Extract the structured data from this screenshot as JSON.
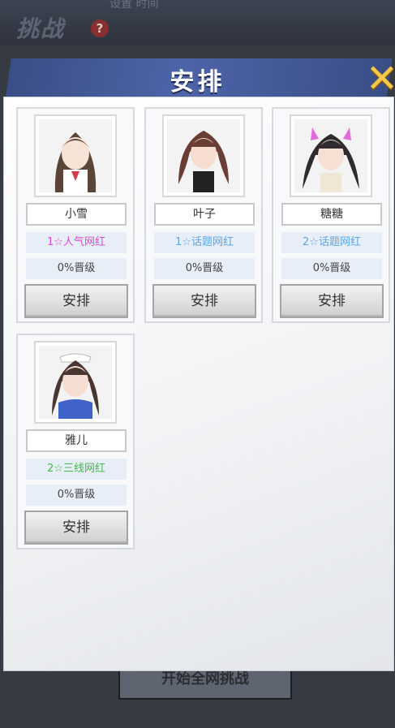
{
  "background": {
    "title": "挑战",
    "top_text": "设置 时间",
    "help_icon": "?",
    "start_button": "开始全网挑战"
  },
  "modal": {
    "title": "安排",
    "close_label": "✕"
  },
  "characters": [
    {
      "name": "小雪",
      "tier": "1☆人气网红",
      "tier_color": "#d94ad8",
      "progress": "0%晋级",
      "button": "安排",
      "hair": "#5b4438",
      "accent": "#d23b4a"
    },
    {
      "name": "叶子",
      "tier": "1☆话题网红",
      "tier_color": "#5aa6e6",
      "progress": "0%晋级",
      "button": "安排",
      "hair": "#6a3d35",
      "accent": "#222222"
    },
    {
      "name": "糖糖",
      "tier": "2☆话题网红",
      "tier_color": "#5aa6e6",
      "progress": "0%晋级",
      "button": "安排",
      "hair": "#2f2a2e",
      "accent": "#e26ad8"
    },
    {
      "name": "雅儿",
      "tier": "2☆三线网红",
      "tier_color": "#43b84a",
      "progress": "0%晋级",
      "button": "安排",
      "hair": "#4a3630",
      "accent": "#3f63c9"
    }
  ]
}
